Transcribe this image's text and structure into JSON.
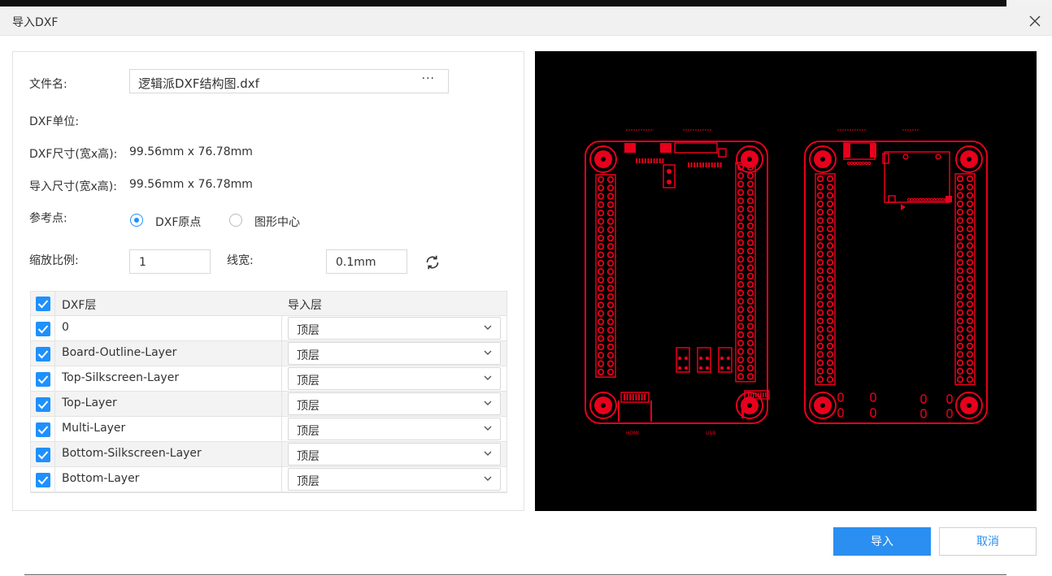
{
  "dialog": {
    "title": "导入DXF"
  },
  "form": {
    "file_label": "文件名:",
    "file_value": "逻辑派DXF结构图.dxf",
    "browse_label": "···",
    "unit_label": "DXF单位:",
    "dxf_size_label": "DXF尺寸(宽x高):",
    "dxf_size_value": "99.56mm x 76.78mm",
    "import_size_label": "导入尺寸(宽x高):",
    "import_size_value": "99.56mm x 76.78mm",
    "ref_label": "参考点:",
    "ref_options": [
      {
        "label": "DXF原点",
        "selected": true
      },
      {
        "label": "图形中心",
        "selected": false
      }
    ],
    "scale_label": "缩放比例:",
    "scale_value": "1",
    "linewidth_label": "线宽:",
    "linewidth_value": "0.1mm"
  },
  "table": {
    "col_dxf_layer": "DXF层",
    "col_import_layer": "导入层",
    "rows": [
      {
        "name": "0",
        "target": "顶层",
        "checked": true
      },
      {
        "name": "Board-Outline-Layer",
        "target": "顶层",
        "checked": true
      },
      {
        "name": "Top-Silkscreen-Layer",
        "target": "顶层",
        "checked": true
      },
      {
        "name": "Top-Layer",
        "target": "顶层",
        "checked": true
      },
      {
        "name": "Multi-Layer",
        "target": "顶层",
        "checked": true
      },
      {
        "name": "Bottom-Silkscreen-Layer",
        "target": "顶层",
        "checked": true
      },
      {
        "name": "Bottom-Layer",
        "target": "顶层",
        "checked": true
      }
    ]
  },
  "preview": {
    "silk_labels": [
      "HDMI",
      "USB"
    ]
  },
  "buttons": {
    "import": "导入",
    "cancel": "取消"
  },
  "colors": {
    "accent": "#2a8ff0",
    "pcb_red": "#e8001c",
    "preview_bg": "#000000"
  }
}
